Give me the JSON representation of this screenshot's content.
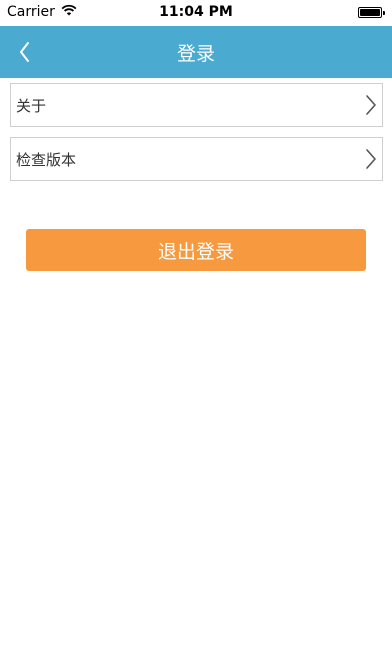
{
  "status_bar": {
    "carrier": "Carrier",
    "time": "11:04 PM",
    "icons": [
      "wifi-icon",
      "battery-icon"
    ]
  },
  "nav_bar": {
    "title": "登录",
    "back_icon": "chevron-left-icon"
  },
  "list": {
    "items": [
      {
        "label": "关于",
        "icon": "chevron-right-icon"
      },
      {
        "label": "检查版本",
        "icon": "chevron-right-icon"
      }
    ]
  },
  "logout_button": {
    "label": "退出登录"
  },
  "colors": {
    "nav_bar_bg": "#4aaad0",
    "logout_button_bg": "#f79a3f",
    "row_border": "#cfcfcf"
  }
}
